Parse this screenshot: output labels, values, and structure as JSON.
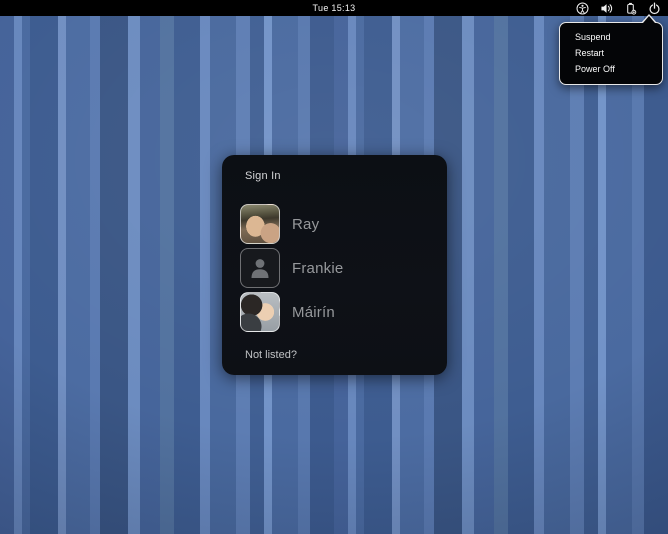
{
  "top_bar": {
    "clock": "Tue 15:13",
    "icons": [
      {
        "name": "accessibility-icon"
      },
      {
        "name": "volume-icon"
      },
      {
        "name": "battery-icon"
      },
      {
        "name": "power-icon"
      }
    ]
  },
  "power_menu": {
    "items": [
      {
        "label": "Suspend"
      },
      {
        "label": "Restart"
      },
      {
        "label": "Power Off"
      }
    ]
  },
  "signin": {
    "title": "Sign In",
    "users": [
      {
        "name": "Ray",
        "avatar": "photo-man-with-cap"
      },
      {
        "name": "Frankie",
        "avatar": "generic-person-silhouette"
      },
      {
        "name": "Máirín",
        "avatar": "photo-two-people"
      }
    ],
    "not_listed_label": "Not listed?"
  },
  "colors": {
    "top_bar_bg": "#000000",
    "menu_bg": "#040507",
    "menu_border": "#e8e8e8",
    "dialog_bg": "#0d1016",
    "wallpaper_base_blue": "#4a6aa0",
    "wallpaper_light_stripe": "#7293c8",
    "wallpaper_dark_stripe": "#3a5685",
    "user_name_text": "#96989b"
  }
}
